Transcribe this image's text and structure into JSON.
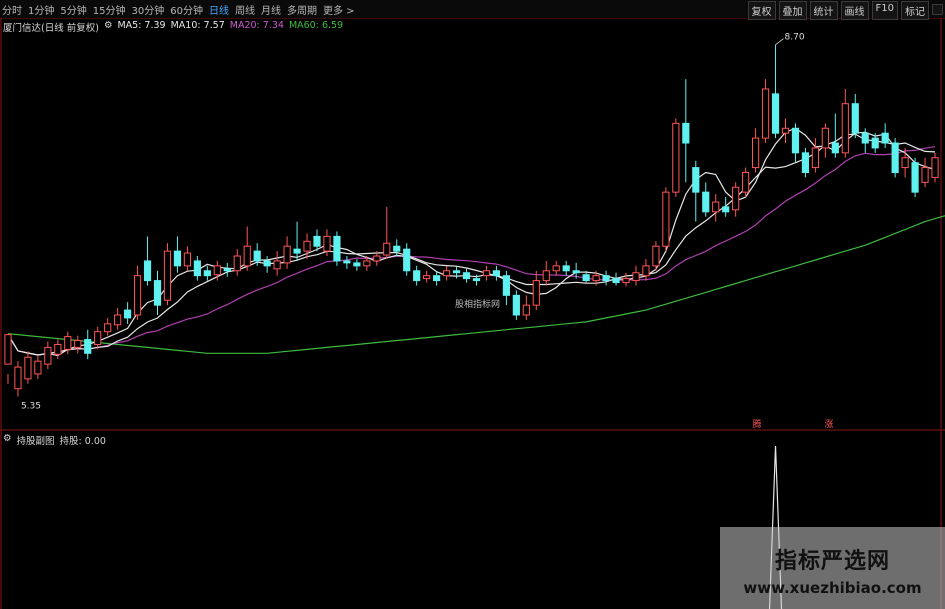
{
  "toolbar": {
    "tabs": [
      "分时",
      "1分钟",
      "5分钟",
      "15分钟",
      "30分钟",
      "60分钟",
      "日线",
      "周线",
      "月线",
      "多周期",
      "更多 >"
    ],
    "active_tab": 6,
    "tools": [
      "复权",
      "叠加",
      "统计",
      "画线",
      "F10",
      "标记"
    ]
  },
  "main_header": {
    "title": "厦门信达(日线 前复权)",
    "ma5": "MA5: 7.39",
    "ma10": "MA10: 7.57",
    "ma20": "MA20: 7.34",
    "ma60": "MA60: 6.59"
  },
  "sub_header": {
    "title": "持股副图",
    "value": "持股: 0.00"
  },
  "colors": {
    "up": "#ff5555",
    "down": "#5ff0f0",
    "ma5": "#e6e6e6",
    "ma10": "#e6e6e6",
    "ma20": "#b040b0",
    "ma60": "#3dbb3d",
    "border": "#8a1515"
  },
  "chart_data": {
    "type": "candlestick",
    "ylim": [
      4.9,
      8.95
    ],
    "annotations": {
      "high_label": "8.70",
      "low_label": "5.35",
      "center_text": "股相指标网",
      "signal_labels": [
        "腾",
        "涨"
      ]
    },
    "candles": [
      [
        5.55,
        5.85,
        5.45,
        5.35
      ],
      [
        5.3,
        5.52,
        5.58,
        5.22
      ],
      [
        5.4,
        5.62,
        5.68,
        5.35
      ],
      [
        5.45,
        5.58,
        5.64,
        5.4
      ],
      [
        5.55,
        5.72,
        5.78,
        5.5
      ],
      [
        5.65,
        5.75,
        5.8,
        5.6
      ],
      [
        5.7,
        5.83,
        5.88,
        5.65
      ],
      [
        5.72,
        5.79,
        5.84,
        5.66
      ],
      [
        5.8,
        5.66,
        5.9,
        5.6
      ],
      [
        5.75,
        5.88,
        5.93,
        5.7
      ],
      [
        5.88,
        5.96,
        6.02,
        5.84
      ],
      [
        5.95,
        6.05,
        6.12,
        5.9
      ],
      [
        6.1,
        6.02,
        6.18,
        5.96
      ],
      [
        6.05,
        6.45,
        6.55,
        6.0
      ],
      [
        6.6,
        6.4,
        6.85,
        6.35
      ],
      [
        6.4,
        6.15,
        6.5,
        6.05
      ],
      [
        6.2,
        6.7,
        6.78,
        6.15
      ],
      [
        6.7,
        6.55,
        6.85,
        6.48
      ],
      [
        6.55,
        6.68,
        6.75,
        6.5
      ],
      [
        6.6,
        6.45,
        6.65,
        6.4
      ],
      [
        6.5,
        6.45,
        6.55,
        6.4
      ],
      [
        6.46,
        6.55,
        6.6,
        6.4
      ],
      [
        6.52,
        6.5,
        6.58,
        6.44
      ],
      [
        6.5,
        6.65,
        6.72,
        6.45
      ],
      [
        6.55,
        6.75,
        6.95,
        6.5
      ],
      [
        6.7,
        6.6,
        6.78,
        6.55
      ],
      [
        6.6,
        6.55,
        6.65,
        6.48
      ],
      [
        6.52,
        6.6,
        6.7,
        6.45
      ],
      [
        6.58,
        6.75,
        6.85,
        6.52
      ],
      [
        6.72,
        6.68,
        7.0,
        6.6
      ],
      [
        6.7,
        6.8,
        6.88,
        6.62
      ],
      [
        6.85,
        6.75,
        6.92,
        6.7
      ],
      [
        6.7,
        6.85,
        6.92,
        6.65
      ],
      [
        6.85,
        6.6,
        6.9,
        6.55
      ],
      [
        6.6,
        6.58,
        6.65,
        6.52
      ],
      [
        6.58,
        6.55,
        6.62,
        6.5
      ],
      [
        6.55,
        6.6,
        6.65,
        6.5
      ],
      [
        6.6,
        6.65,
        6.7,
        6.55
      ],
      [
        6.66,
        6.78,
        7.15,
        6.62
      ],
      [
        6.75,
        6.7,
        6.82,
        6.65
      ],
      [
        6.72,
        6.5,
        6.78,
        6.45
      ],
      [
        6.5,
        6.4,
        6.55,
        6.35
      ],
      [
        6.42,
        6.45,
        6.5,
        6.38
      ],
      [
        6.45,
        6.4,
        6.5,
        6.35
      ],
      [
        6.45,
        6.5,
        6.55,
        6.4
      ],
      [
        6.5,
        6.48,
        6.55,
        6.42
      ],
      [
        6.48,
        6.42,
        6.52,
        6.38
      ],
      [
        6.42,
        6.4,
        6.46,
        6.35
      ],
      [
        6.45,
        6.5,
        6.55,
        6.4
      ],
      [
        6.5,
        6.45,
        6.55,
        6.4
      ],
      [
        6.45,
        6.25,
        6.5,
        6.15
      ],
      [
        6.25,
        6.05,
        6.3,
        6.0
      ],
      [
        6.05,
        6.15,
        6.25,
        6.0
      ],
      [
        6.15,
        6.4,
        6.5,
        6.1
      ],
      [
        6.4,
        6.5,
        6.6,
        6.35
      ],
      [
        6.5,
        6.55,
        6.6,
        6.45
      ],
      [
        6.55,
        6.5,
        6.6,
        6.45
      ],
      [
        6.5,
        6.48,
        6.58,
        6.42
      ],
      [
        6.46,
        6.4,
        6.5,
        6.38
      ],
      [
        6.4,
        6.45,
        6.5,
        6.35
      ],
      [
        6.45,
        6.4,
        6.5,
        6.35
      ],
      [
        6.42,
        6.38,
        6.48,
        6.35
      ],
      [
        6.38,
        6.42,
        6.48,
        6.34
      ],
      [
        6.4,
        6.48,
        6.55,
        6.35
      ],
      [
        6.45,
        6.55,
        6.62,
        6.4
      ],
      [
        6.55,
        6.75,
        6.8,
        6.5
      ],
      [
        6.75,
        7.3,
        7.35,
        6.7
      ],
      [
        7.3,
        8.0,
        8.05,
        7.25
      ],
      [
        8.0,
        7.8,
        8.45,
        7.4
      ],
      [
        7.55,
        7.3,
        7.62,
        7.0
      ],
      [
        7.3,
        7.1,
        7.4,
        7.05
      ],
      [
        7.1,
        7.2,
        7.28,
        7.0
      ],
      [
        7.15,
        7.1,
        7.25,
        7.05
      ],
      [
        7.12,
        7.35,
        7.4,
        7.05
      ],
      [
        7.3,
        7.5,
        7.55,
        7.25
      ],
      [
        7.55,
        7.85,
        7.95,
        7.5
      ],
      [
        7.85,
        8.35,
        8.45,
        7.8
      ],
      [
        8.3,
        7.9,
        8.8,
        7.85
      ],
      [
        7.9,
        7.95,
        8.05,
        7.8
      ],
      [
        7.95,
        7.7,
        8.0,
        7.6
      ],
      [
        7.7,
        7.5,
        7.75,
        7.45
      ],
      [
        7.55,
        7.75,
        7.85,
        7.5
      ],
      [
        7.75,
        7.95,
        8.0,
        7.65
      ],
      [
        7.8,
        7.7,
        8.1,
        7.65
      ],
      [
        7.7,
        8.2,
        8.35,
        7.65
      ],
      [
        8.2,
        7.9,
        8.3,
        7.85
      ],
      [
        7.9,
        7.8,
        7.95,
        7.7
      ],
      [
        7.85,
        7.75,
        7.9,
        7.7
      ],
      [
        7.9,
        7.8,
        8.0,
        7.75
      ],
      [
        7.8,
        7.5,
        7.85,
        7.45
      ],
      [
        7.55,
        7.65,
        7.75,
        7.45
      ],
      [
        7.6,
        7.3,
        7.65,
        7.25
      ],
      [
        7.4,
        7.55,
        7.65,
        7.35
      ],
      [
        7.45,
        7.65,
        7.7,
        7.4
      ]
    ],
    "ma60": [
      5.86,
      5.85,
      5.84,
      5.83,
      5.82,
      5.81,
      5.8,
      5.79,
      5.78,
      5.77,
      5.76,
      5.75,
      5.74,
      5.73,
      5.72,
      5.71,
      5.7,
      5.69,
      5.68,
      5.67,
      5.66,
      5.66,
      5.66,
      5.66,
      5.66,
      5.66,
      5.66,
      5.67,
      5.68,
      5.69,
      5.7,
      5.71,
      5.72,
      5.73,
      5.74,
      5.75,
      5.76,
      5.77,
      5.78,
      5.79,
      5.8,
      5.81,
      5.82,
      5.83,
      5.84,
      5.85,
      5.86,
      5.87,
      5.88,
      5.89,
      5.9,
      5.91,
      5.92,
      5.93,
      5.94,
      5.95,
      5.96,
      5.97,
      5.98,
      6.0,
      6.02,
      6.04,
      6.06,
      6.08,
      6.1,
      6.13,
      6.16,
      6.19,
      6.22,
      6.25,
      6.28,
      6.31,
      6.34,
      6.37,
      6.4,
      6.43,
      6.46,
      6.49,
      6.52,
      6.55,
      6.58,
      6.61,
      6.64,
      6.67,
      6.7,
      6.73,
      6.76,
      6.8,
      6.84,
      6.88,
      6.92,
      6.96,
      7.0,
      7.03,
      7.06
    ],
    "subchart": {
      "name": "持股",
      "ylim": [
        0,
        1
      ],
      "values_note": "spike",
      "spike_index": 77,
      "spike_value": 1
    }
  }
}
